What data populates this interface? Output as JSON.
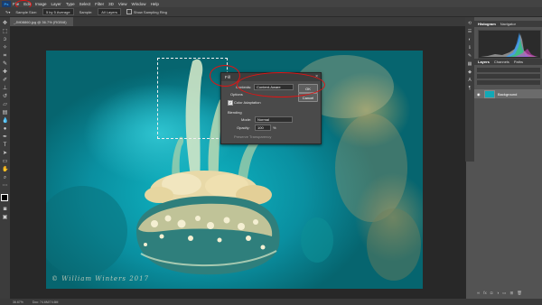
{
  "menubar": {
    "app_icon": "Ps",
    "items": [
      "File",
      "Edit",
      "Image",
      "Layer",
      "Type",
      "Select",
      "Filter",
      "3D",
      "View",
      "Window",
      "Help"
    ]
  },
  "options": {
    "sample_size_label": "Sample Size:",
    "sample_size_value": "5 by 5 Average",
    "sample_label": "Sample:",
    "sample_value": "All Layers",
    "show_ring_label": "Show Sampling Ring"
  },
  "document": {
    "tab_title": "_JM08860.jpg @ 36.7% (RGB/8)"
  },
  "status": {
    "zoom": "36.67%",
    "doc_size": "Doc: 74.6M/74.6M"
  },
  "dialog": {
    "title": "Fill",
    "contents_label": "Contents:",
    "contents_value": "Content-Aware",
    "ok_label": "OK",
    "cancel_label": "Cancel",
    "options_label": "Options",
    "color_adaptation_label": "Color Adaptation",
    "blending_label": "Blending",
    "mode_label": "Mode:",
    "mode_value": "Normal",
    "opacity_label": "Opacity:",
    "opacity_value": "100",
    "opacity_unit": "%",
    "preserve_label": "Preserve Transparency"
  },
  "panels": {
    "histogram_tabs": [
      "Histogram",
      "Navigator"
    ],
    "layers_tabs": [
      "Layers",
      "Channels",
      "Paths"
    ],
    "layer_name": "Background"
  },
  "watermark": "© William Winters 2017",
  "accent": "#31a8ff",
  "annotation_color": "#e01414"
}
